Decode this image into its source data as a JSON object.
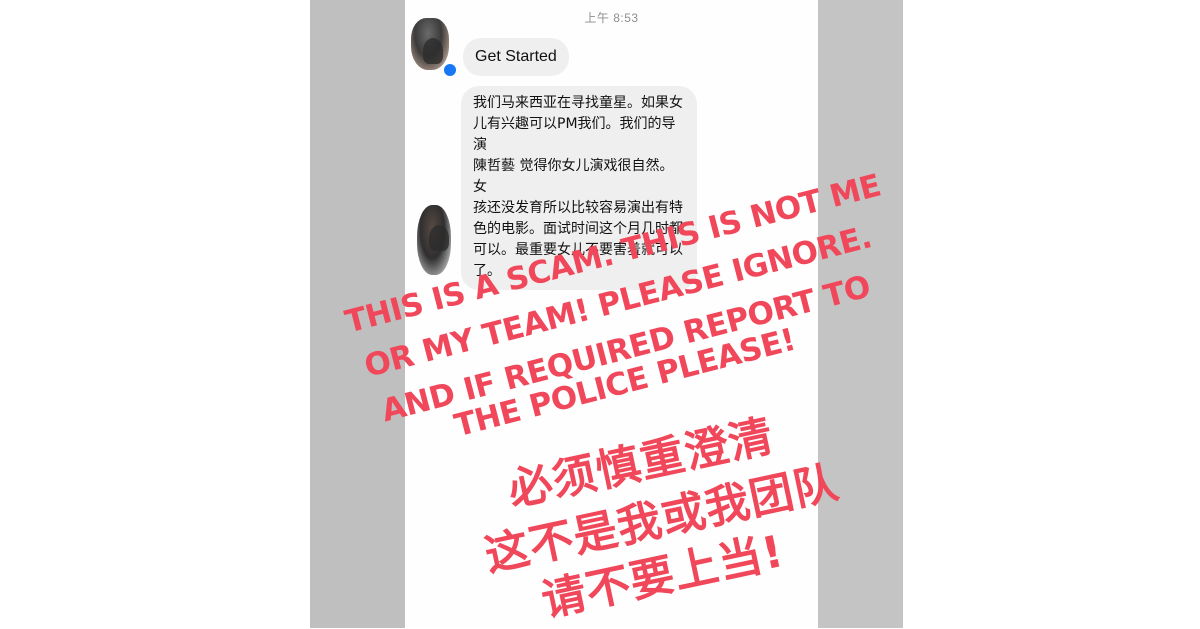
{
  "status_bar": {
    "time": "上午 8:53"
  },
  "conversation": {
    "messages": [
      {
        "sender_avatar": "profile-avatar",
        "text": "Get Started"
      },
      {
        "sender_avatar": "profile-avatar",
        "text": "我们马来西亚在寻找童星。如果女\n儿有兴趣可以PM我们。我们的导演\n陳哲藝 觉得你女儿演戏很自然。女\n孩还没发育所以比较容易演出有特\n色的电影。面试时间这个月几时都\n可以。最重要女儿不要害羞就可以\n了。"
      }
    ]
  },
  "overlay": {
    "color": "#f0485a",
    "english_lines": [
      "THIS IS A SCAM. THIS IS NOT ME",
      "OR MY TEAM! PLEASE IGNORE.",
      "AND IF REQUIRED REPORT TO",
      "THE POLICE PLEASE!"
    ],
    "chinese_lines": [
      "必须慎重澄清",
      "这不是我或我团队",
      "请不要上当!"
    ]
  },
  "colors": {
    "bubble_bg": "#efefef",
    "page_bg": "#ffffff",
    "side_gray": "#bfbfbf",
    "messenger_badge": "#1877f2"
  }
}
